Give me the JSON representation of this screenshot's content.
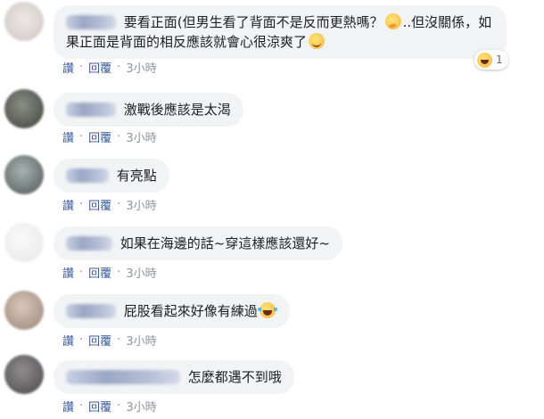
{
  "actions": {
    "like": "讚",
    "reply": "回覆",
    "time": "3小時",
    "separator": "·"
  },
  "comments": [
    {
      "text_before": "要看正面(但男生看了背面不是反而更熱嗎？",
      "text_middle": "..但沒關係，如果正面是背面的相反應該就會心很涼爽了",
      "emoji_1": "thinking-face",
      "emoji_2": "smiling-face",
      "avatar_color": "#d9d2cf",
      "reaction": {
        "emoji": "laughing-face",
        "count": "1"
      }
    },
    {
      "text": "激戰後應該是太渴",
      "avatar_color": "#5a5f57"
    },
    {
      "text": "有亮點",
      "avatar_color": "#7e8a87"
    },
    {
      "text": "如果在海邊的話~穿這樣應該還好~",
      "avatar_color": "#eeeeee"
    },
    {
      "text": "屁股看起來好像有練過",
      "emoji": "tears-of-joy-face",
      "avatar_color": "#c8b3a7"
    },
    {
      "text": "怎麼都遇不到哦",
      "avatar_color": "#6d6b6c"
    }
  ]
}
